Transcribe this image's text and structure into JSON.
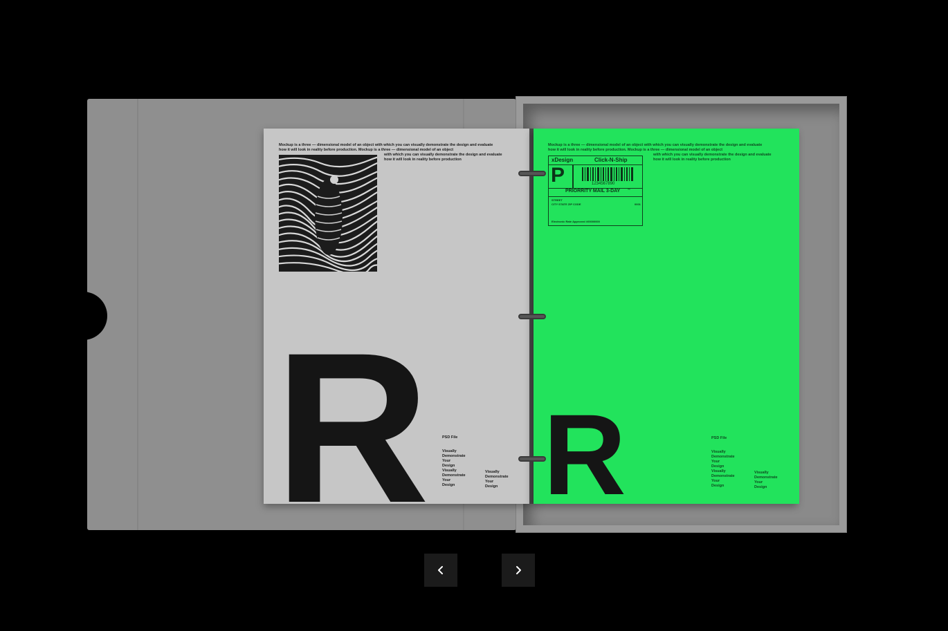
{
  "left_page": {
    "intro_line1": "Mockup is a three — dimensional model of an object with which you can visually demonstrate the design and evaluate",
    "intro_line2": "how it will look in reality before production. Mockup is a three — dimensional model of an object",
    "intro_line3": "with which you can visually demonstrate the design and evaluate",
    "intro_line4": "how it will look in reality before production",
    "big_letter": "R",
    "psd_label": "PSD File",
    "col1": [
      "Visually",
      "Demonstrate",
      "Your",
      "Design",
      "Visually",
      "Demonstrate",
      "Your",
      "Design"
    ],
    "col2": [
      "Visually",
      "Demonstrate",
      "Your",
      "Design"
    ]
  },
  "right_page": {
    "intro_line1": "Mockup is a three — dimensional model of an object with which you can visually demonstrate the design and evaluate",
    "intro_line2": "how it will look in reality before production. Mockup is a three — dimensional model of an object",
    "intro_line3": "with which you can visually demonstrate the design and evaluate",
    "intro_line4": "how it will look in reality before production",
    "label": {
      "brand": "xDesign",
      "service": "Click-N-Ship",
      "big_p": "P",
      "barcode_number": "1234567890",
      "priority": "PRIORRITY MAIL 3-DAY",
      "tm": "™",
      "street": "STREET",
      "city": "CITY STATE ZIP CODE",
      "code": "0001",
      "footer": "Electronic Rate Approved #00000000"
    },
    "big_letter": "R",
    "psd_label": "PSD File",
    "col1": [
      "Visually",
      "Demonstrate",
      "Your",
      "Design",
      "Visually",
      "Demonstrate",
      "Your",
      "Design"
    ],
    "col2": [
      "Visually",
      "Demonstrate",
      "Your",
      "Design"
    ]
  },
  "nav": {
    "prev_icon": "chevron-left-icon",
    "next_icon": "chevron-right-icon"
  },
  "colors": {
    "background": "#000000",
    "accent_green": "#22e35c",
    "paper_gray": "#c6c6c6"
  }
}
